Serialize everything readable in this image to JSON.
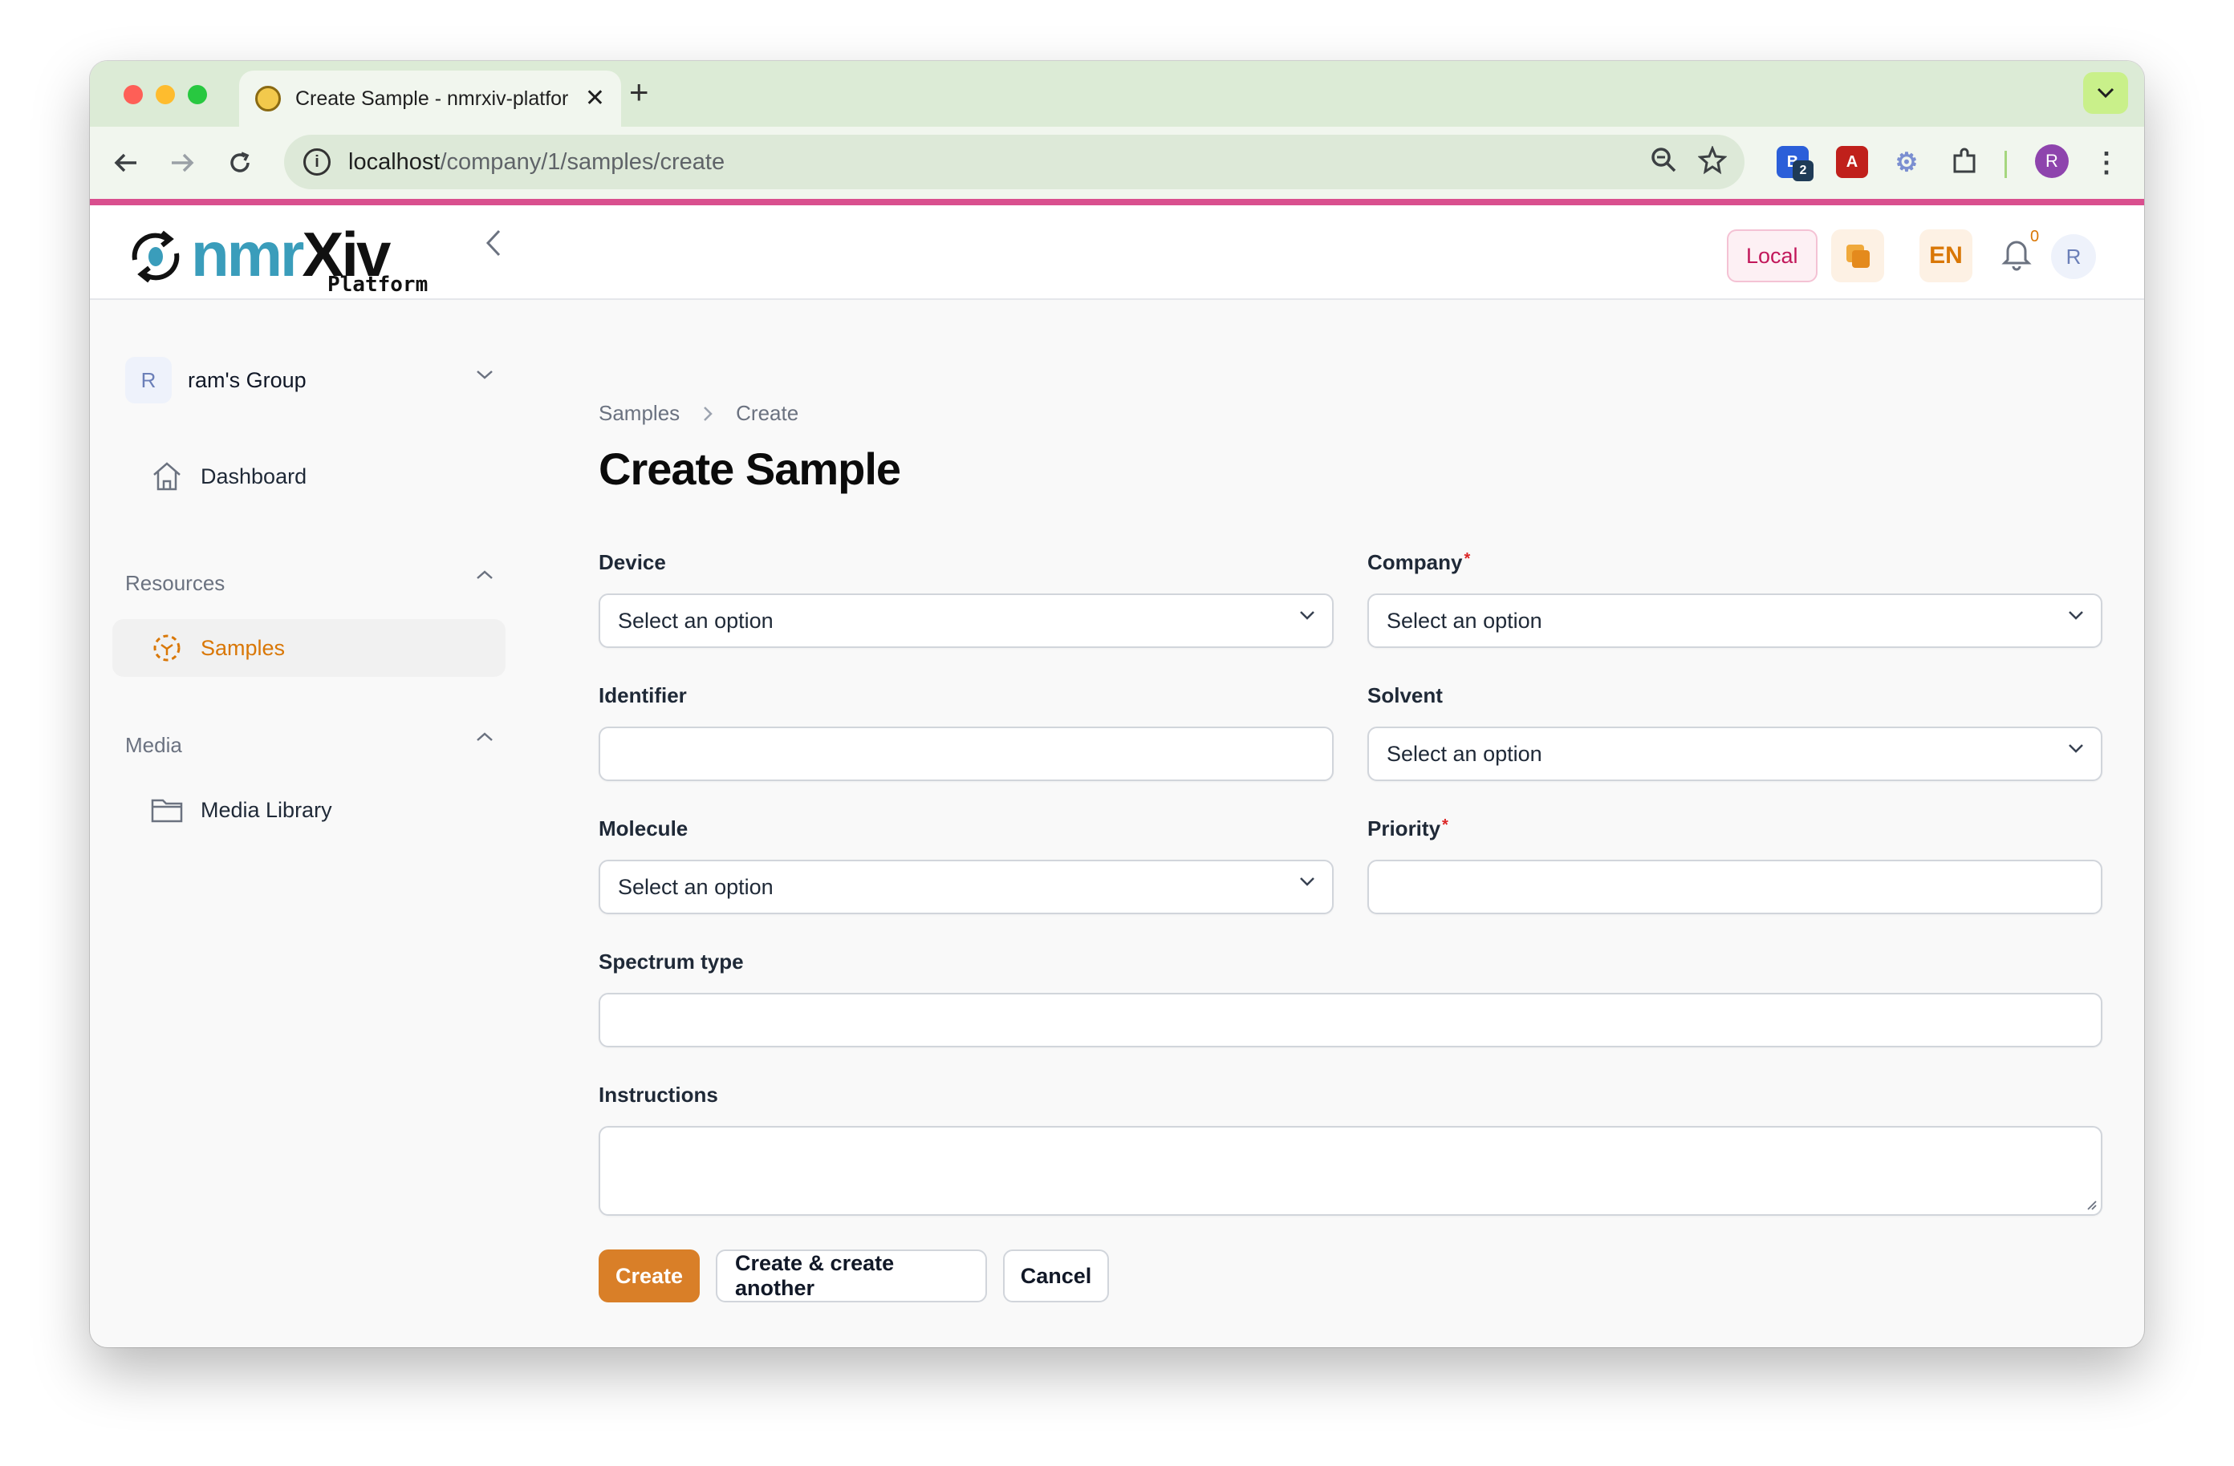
{
  "browser": {
    "tab_title": "Create Sample - nmrxiv-platform",
    "tab_close": "✕",
    "new_tab": "+",
    "url_host": "localhost",
    "url_path": "/company/1/samples/create",
    "ext_badge_count": "2",
    "profile_initial": "R",
    "accent_color": "#d94f8e"
  },
  "header": {
    "logo_primary": "nmr",
    "logo_secondary": "Xiv",
    "logo_sub": "Platform",
    "env_badge": "Local",
    "language": "EN",
    "notification_count": "0",
    "user_initial": "R"
  },
  "sidebar": {
    "group_initial": "R",
    "group_name": "ram's Group",
    "dashboard": "Dashboard",
    "resources_header": "Resources",
    "samples": "Samples",
    "media_header": "Media",
    "media_library": "Media Library"
  },
  "main": {
    "breadcrumb": [
      "Samples",
      "Create"
    ],
    "title": "Create Sample",
    "fields": {
      "device": {
        "label": "Device",
        "value": "Select an option"
      },
      "company": {
        "label": "Company",
        "value": "Select an option",
        "required_mark": "*"
      },
      "identifier": {
        "label": "Identifier",
        "value": ""
      },
      "solvent": {
        "label": "Solvent",
        "value": "Select an option"
      },
      "molecule": {
        "label": "Molecule",
        "value": "Select an option"
      },
      "priority": {
        "label": "Priority",
        "value": "",
        "required_mark": "*"
      },
      "spectrum_type": {
        "label": "Spectrum type",
        "value": ""
      },
      "instructions": {
        "label": "Instructions",
        "value": ""
      }
    },
    "buttons": {
      "create": "Create",
      "create_another": "Create & create another",
      "cancel": "Cancel"
    },
    "accent_color": "#d97f28"
  }
}
